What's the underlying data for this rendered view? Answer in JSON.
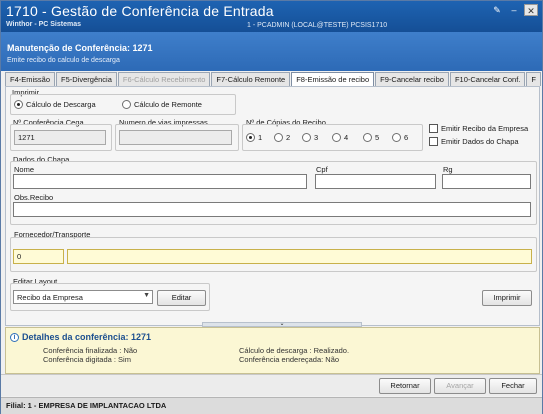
{
  "window": {
    "title": "1710 - Gestão de Conferência de Entrada",
    "subtitle": "Winthor - PC Sistemas",
    "info": "1 - PCADMIN (LOCAL@TESTE)   PCSIS1710"
  },
  "header": {
    "title": "Manutenção de Conferência: 1271",
    "subtitle": "Emite recibo do calculo de descarga"
  },
  "tabs": [
    {
      "label": "F4-Emissão",
      "state": "normal"
    },
    {
      "label": "F5-Divergência",
      "state": "normal"
    },
    {
      "label": "F6-Cálculo Recebimento",
      "state": "disabled"
    },
    {
      "label": "F7-Cálculo Remonte",
      "state": "normal"
    },
    {
      "label": "F8-Emissão de recibo",
      "state": "active"
    },
    {
      "label": "F9-Cancelar recibo",
      "state": "normal"
    },
    {
      "label": "F10-Cancelar Conf.",
      "state": "normal"
    },
    {
      "label": "F",
      "state": "normal"
    }
  ],
  "imprimir": {
    "label": "Imprimir",
    "options": [
      "Cálculo de Descarga",
      "Cálculo de Remonte"
    ],
    "selected": "Cálculo de Descarga"
  },
  "fields": {
    "conferencia_cega_label": "Nº Conferência Cega",
    "conferencia_cega_value": "1271",
    "vias_label": "Numero de vias impressas",
    "vias_value": "",
    "copias_label": "Nº de Cópias do Recibo",
    "copias_options": [
      "1",
      "2",
      "3",
      "4",
      "5",
      "6"
    ],
    "copias_selected": "1"
  },
  "checkboxes": {
    "emitir_recibo_empresa": "Emitir Recibo da Empresa",
    "emitir_dados_chapa": "Emitir Dados do Chapa"
  },
  "chapa": {
    "section_label": "Dados do Chapa",
    "nome_label": "Nome",
    "cpf_label": "Cpf",
    "rg_label": "Rg",
    "obs_label": "Obs.Recibo"
  },
  "fornecedor": {
    "label": "Fornecedor/Transporte",
    "code": "0",
    "name": ""
  },
  "layout": {
    "label": "Editar Layout",
    "selected": "Recibo da Empresa",
    "editar_button": "Editar",
    "imprimir_button": "Imprimir"
  },
  "details": {
    "title": "Detalhes da conferência: 1271",
    "lines_left": [
      "Conferência finalizada : Não",
      "Conferência digitada : Sim"
    ],
    "lines_right": [
      "Cálculo de descarga : Realizado.",
      "Conferência endereçada: Não"
    ]
  },
  "footer": {
    "retornar": "Retornar",
    "avancar": "Avançar",
    "fechar": "Fechar"
  },
  "status": {
    "filial": "Filial: 1 - EMPRESA DE IMPLANTACAO LTDA"
  }
}
